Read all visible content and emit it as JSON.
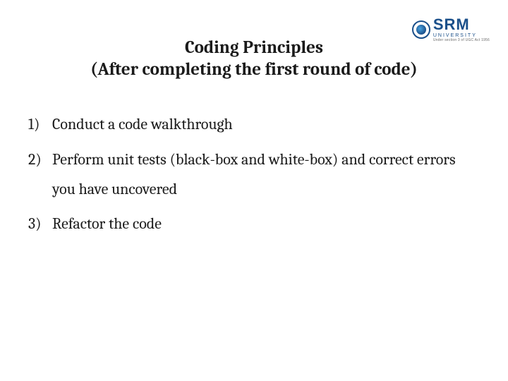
{
  "logo": {
    "main": "SRM",
    "sub": "UNIVERSITY",
    "tag": "Under section 3 of UGC Act 1956"
  },
  "title": {
    "line1": "Coding Principles",
    "line2": "(After completing the first round of code)"
  },
  "items": [
    {
      "num": "1)",
      "text": "Conduct a code walkthrough"
    },
    {
      "num": "2)",
      "text": "Perform unit tests (black-box and white-box) and correct errors you have uncovered"
    },
    {
      "num": "3)",
      "text": "Refactor the code"
    }
  ]
}
